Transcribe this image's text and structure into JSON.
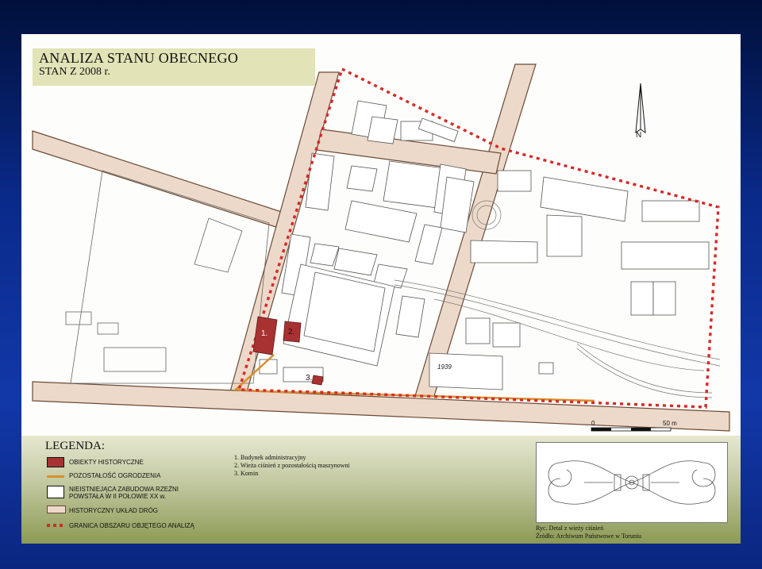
{
  "title": "ANALIZA STANU OBECNEGO",
  "subtitle": "STAN Z 2008 r.",
  "north_label": "N",
  "scale": {
    "start": "0",
    "end": "50 m"
  },
  "map_labels": {
    "building_1": "1.",
    "building_2": "2.",
    "building_3": "3.",
    "year_mark": "1939"
  },
  "legend": {
    "heading": "LEGENDA:",
    "items": [
      {
        "label": "OBIEKTY  HISTORYCZNE",
        "color": "#a83232"
      },
      {
        "label": "POZOSTAŁOŚĆ OGRODZENIA",
        "color": "#d8902a"
      },
      {
        "label": "NIEISTNIEJĄCA ZABUDOWA RZEŹNI POWSTAŁA W II POŁOWIE XX w.",
        "color": "#ffffff"
      },
      {
        "label": "HISTORYCZNY UKŁAD DRÓG",
        "color": "#ecd9c9"
      },
      {
        "label": "GRANICA OBSZARU OBJĘTEGO ANALIZĄ",
        "color": "#d42a2a"
      }
    ]
  },
  "notes": [
    "1.  Budynek administracyjny",
    "2.  Wieża ciśnień z pozostałością maszynowni",
    "3.  Komin"
  ],
  "caption": {
    "line1": "Ryc. Detal z wieży ciśnień",
    "line2": "Źródło: Archiwum Państwowe w Toruniu"
  }
}
